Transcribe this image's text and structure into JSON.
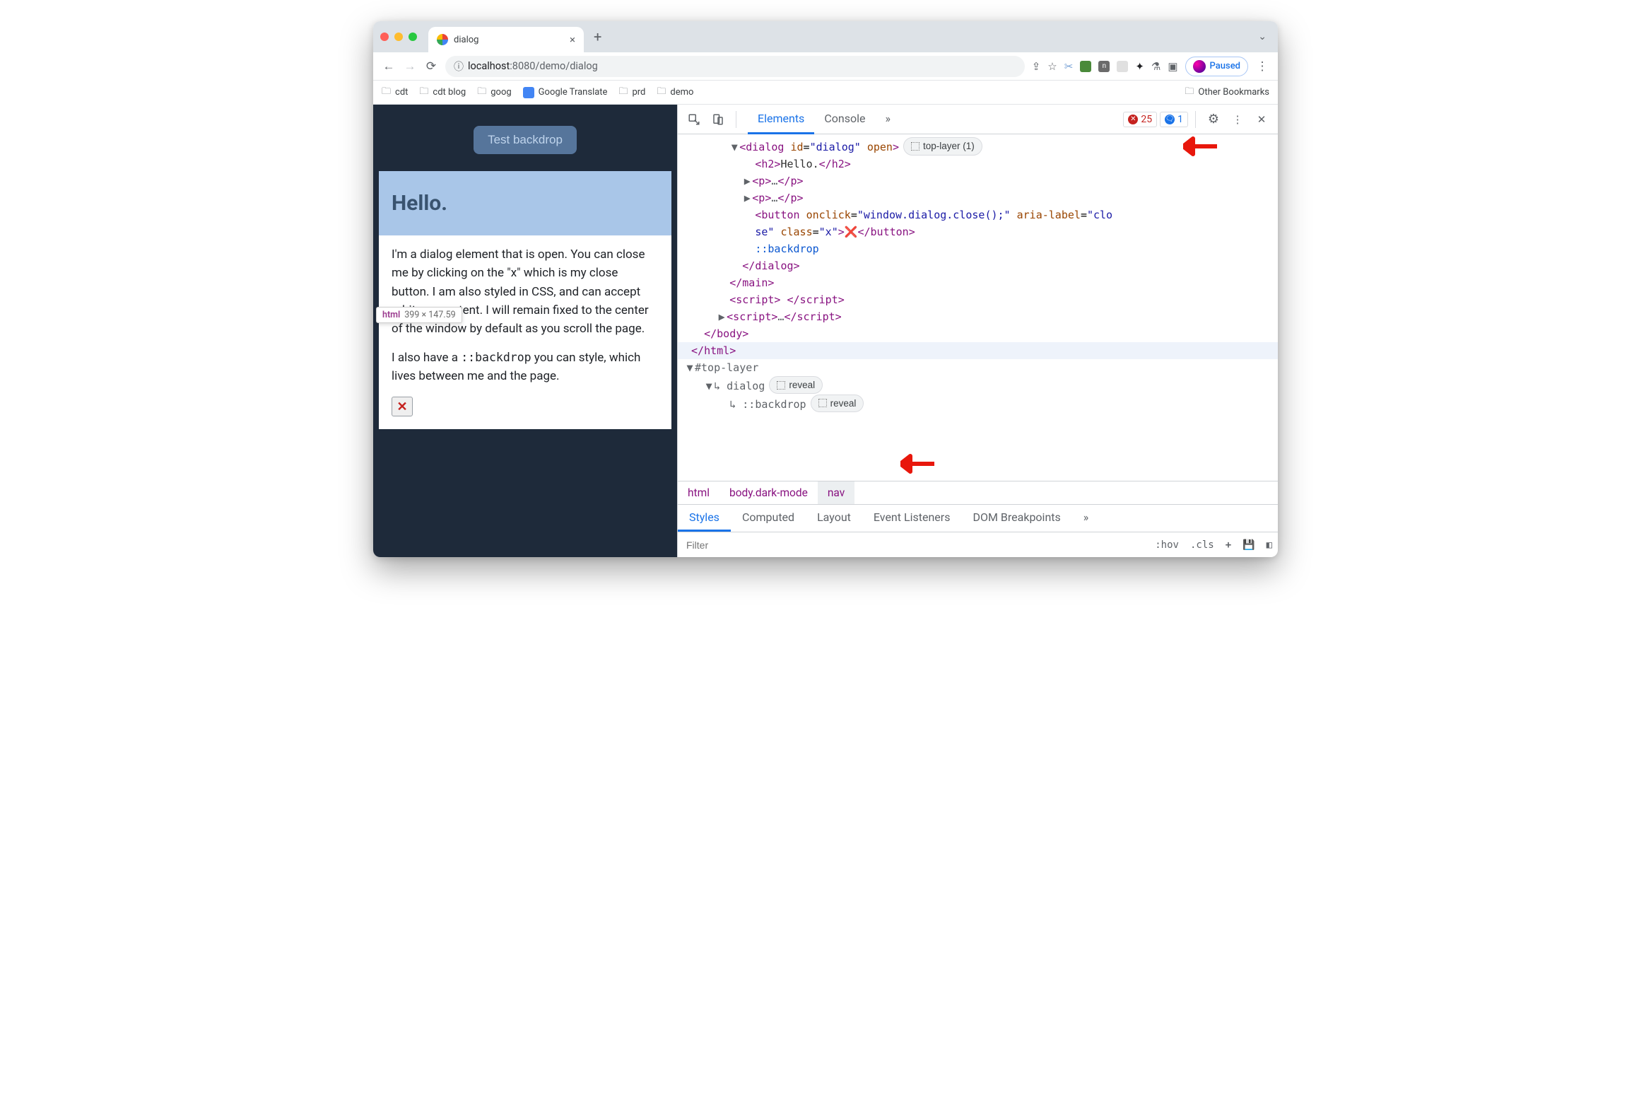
{
  "tabstrip": {
    "tab_title": "dialog",
    "close_glyph": "×",
    "newtab_glyph": "+",
    "dropdown_glyph": "⌄"
  },
  "toolbar": {
    "back": "←",
    "fwd": "→",
    "reload": "⟳",
    "info_glyph": "ⓘ",
    "url_host": "localhost",
    "url_port": ":8080",
    "url_path": "/demo/dialog",
    "share": "⇪",
    "star": "☆",
    "scissors": "✂",
    "puzzle": "✦",
    "flask": "⚗",
    "panel": "▣",
    "paused": "Paused",
    "menu": "⋮"
  },
  "bookmarks": {
    "items": [
      "cdt",
      "cdt blog",
      "goog",
      "Google Translate",
      "prd",
      "demo"
    ],
    "other": "Other Bookmarks"
  },
  "page": {
    "test_backdrop": "Test backdrop",
    "hello": "Hello.",
    "tooltip_tag": "html",
    "tooltip_dims": "399 × 147.59",
    "p1": "I'm a dialog element that is open. You can close me by clicking on the \"x\" which is my close button. I am also styled in CSS, and can accept arbitrary content. I will remain fixed to the center of the window by default as you scroll the page.",
    "p2a": "I also have a ",
    "p2code": "::backdrop",
    "p2b": " you can style, which lives between me and the page.",
    "close_x": "✕"
  },
  "devtools": {
    "tabs": {
      "elements": "Elements",
      "console": "Console",
      "more": "»"
    },
    "errors": "25",
    "issues": "1",
    "gear": "⚙",
    "menu": "⋮",
    "close": "✕",
    "badge_toplayer": "top-layer (1)",
    "badge_reveal": "reveal",
    "dom": {
      "dialog_open": "<dialog id=\"dialog\" open>",
      "h2": "<h2>Hello.</h2>",
      "p_ellipsis": "<p>…</p>",
      "button_l1": "<button onclick=\"window.dialog.close();\" aria-label=\"clo",
      "button_l2": "se\" class=\"x\">",
      "button_l2x": "❌",
      "button_l2end": "</button>",
      "backdrop": "::backdrop",
      "dialog_close": "</dialog>",
      "main_close": "</main>",
      "script_empty": "<script> </script>",
      "script_ellipsis": "<script>…</script>",
      "body_close": "</body>",
      "html_close": "</html>",
      "toplayer": "#top-layer",
      "tl_dialog": "dialog",
      "tl_backdrop": "::backdrop"
    },
    "crumbs": [
      "html",
      "body.dark-mode",
      "nav"
    ],
    "style_tabs": [
      "Styles",
      "Computed",
      "Layout",
      "Event Listeners",
      "DOM Breakpoints",
      "»"
    ],
    "filter_placeholder": "Filter",
    "hov": ":hov",
    "cls": ".cls",
    "plus": "+"
  }
}
